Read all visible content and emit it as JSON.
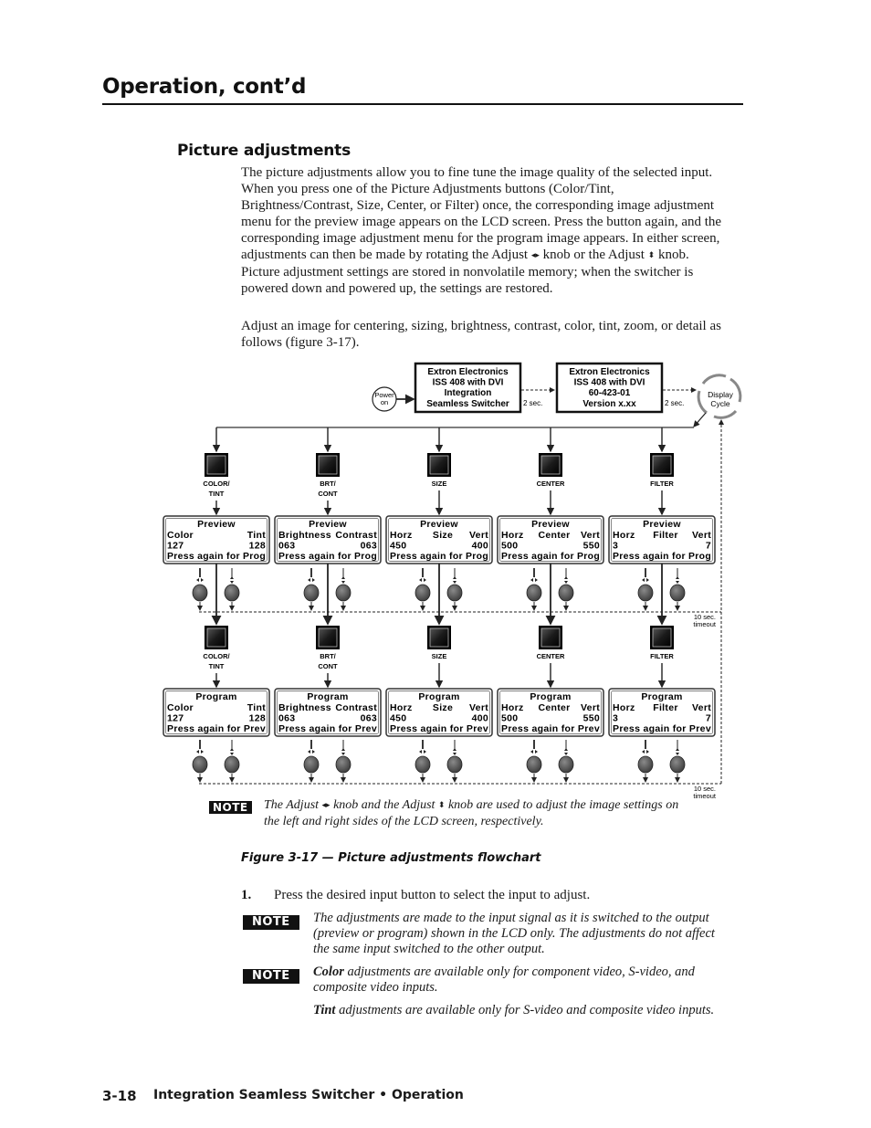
{
  "header": {
    "title": "Operation, cont’d"
  },
  "section": {
    "title": "Picture adjustments",
    "paragraph1_parts": [
      "The picture adjustments allow you to fine tune the image quality of the selected input.  When you press one of the Picture Adjustments buttons (Color/Tint, Brightness/Contrast, Size, Center, or Filter) once, the corresponding image adjustment menu for the preview image appears on the LCD screen.  Press the button again, and the corresponding image adjustment menu for the program image appears.  In either screen, adjustments can then be made by rotating the Adjust ",
      " knob or the Adjust ",
      " knob.  Picture adjustment settings are stored in nonvolatile memory; when the switcher is powered down and powered up, the settings are restored."
    ],
    "paragraph2": "Adjust an image for centering, sizing, brightness, contrast, color, tint, zoom, or detail as follows (figure 3-17).",
    "horizontal_icon": "◂▸",
    "vertical_icon": "⬍"
  },
  "flowchart": {
    "power_on": [
      "Power",
      "on"
    ],
    "startup_lcd": [
      "Extron Electronics",
      "ISS 408 with DVI",
      "Integration",
      "Seamless Switcher"
    ],
    "version_lcd": [
      "Extron Electronics",
      "ISS 408 with DVI",
      "60-423-01",
      "Version x.xx"
    ],
    "delay1": "2 sec.",
    "delay2": "2 sec.",
    "display_cycle": [
      "Display",
      "Cycle"
    ],
    "timeout1": [
      "10 sec.",
      "timeout"
    ],
    "timeout2": [
      "10 sec.",
      "timeout"
    ],
    "buttons": [
      {
        "label": [
          "COLOR/",
          "TINT"
        ]
      },
      {
        "label": [
          "BRT/",
          "CONT"
        ]
      },
      {
        "label": [
          "SIZE"
        ]
      },
      {
        "label": [
          "CENTER"
        ]
      },
      {
        "label": [
          "FILTER"
        ]
      }
    ],
    "preview_screens": [
      {
        "title": "Preview",
        "left_label": "Color",
        "mid_label": "",
        "right_label": "Tint",
        "left_value": "127",
        "right_value": "128",
        "footer": "Press again for Prog"
      },
      {
        "title": "Preview",
        "left_label": "Brightness",
        "mid_label": "",
        "right_label": "Contrast",
        "left_value": "063",
        "right_value": "063",
        "footer": "Press again for Prog"
      },
      {
        "title": "Preview",
        "left_label": "Horz",
        "mid_label": "Size",
        "right_label": "Vert",
        "left_value": "450",
        "right_value": "400",
        "footer": "Press again for Prog"
      },
      {
        "title": "Preview",
        "left_label": "Horz",
        "mid_label": "Center",
        "right_label": "Vert",
        "left_value": "500",
        "right_value": "550",
        "footer": "Press again for Prog"
      },
      {
        "title": "Preview",
        "left_label": "Horz",
        "mid_label": "Filter",
        "right_label": "Vert",
        "left_value": " 3",
        "right_value": "7",
        "footer": "Press again for Prog"
      }
    ],
    "program_screens": [
      {
        "title": "Program",
        "left_label": "Color",
        "mid_label": "",
        "right_label": "Tint",
        "left_value": "127",
        "right_value": "128",
        "footer": "Press again for Prev"
      },
      {
        "title": "Program",
        "left_label": "Brightness",
        "mid_label": "",
        "right_label": "Contrast",
        "left_value": "063",
        "right_value": "063",
        "footer": "Press again for Prev"
      },
      {
        "title": "Program",
        "left_label": "Horz",
        "mid_label": "Size",
        "right_label": "Vert",
        "left_value": "450",
        "right_value": "400",
        "footer": "Press again for Prev"
      },
      {
        "title": "Program",
        "left_label": "Horz",
        "mid_label": "Center",
        "right_label": "Vert",
        "left_value": "500",
        "right_value": "550",
        "footer": "Press again for Prev"
      },
      {
        "title": "Program",
        "left_label": "Horz",
        "mid_label": "Filter",
        "right_label": "Vert",
        "left_value": " 3",
        "right_value": "7",
        "footer": "Press again for Prev"
      }
    ]
  },
  "figure_note": {
    "badge": "NOTE",
    "parts": [
      "The Adjust ",
      " knob and the Adjust ",
      " knob are used to adjust the image settings on the left and right sides of the LCD screen, respectively."
    ]
  },
  "caption": "Figure 3-17 — Picture adjustments flowchart",
  "steps": [
    {
      "number": "1.",
      "text": "Press the desired input button to select the input to adjust."
    }
  ],
  "notes": [
    {
      "badge": "NOTE",
      "text": "The adjustments are made to the input signal as it is switched to the output (preview or program) shown in the LCD only.  The adjustments do not affect the same input switched to the other output."
    },
    {
      "badge": "NOTE",
      "bold": "Color",
      "text": " adjustments are available only for component video, S-video, and composite video inputs."
    }
  ],
  "tint_note": {
    "bold": "Tint",
    "text": " adjustments are available only for S-video and composite video inputs."
  },
  "footer": {
    "page_number": "3-18",
    "text": "Integration Seamless Switcher • Operation"
  }
}
